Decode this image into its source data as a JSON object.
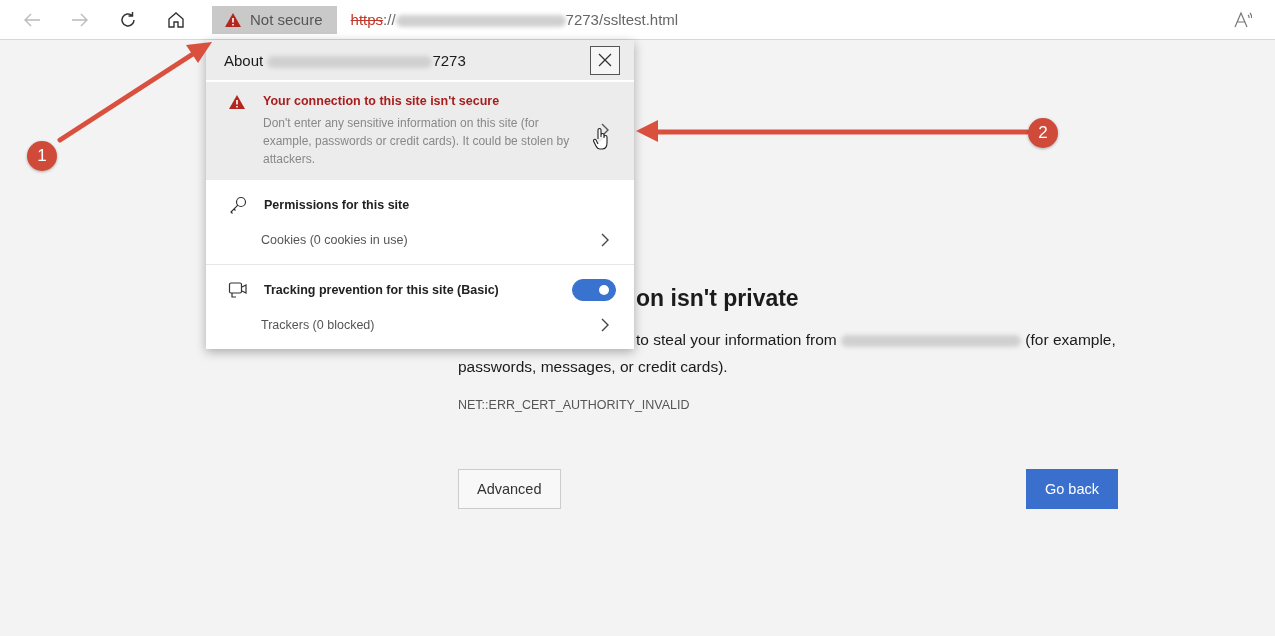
{
  "toolbar": {
    "security_chip": {
      "label": "Not secure"
    },
    "address": {
      "scheme": "https",
      "separator": "://",
      "rest": "7273/ssltest.html"
    }
  },
  "popup": {
    "title_prefix": "About",
    "title_suffix": "7273",
    "warning": {
      "title": "Your connection to this site isn't secure",
      "body": "Don't enter any sensitive information on this site (for example, passwords or credit cards). It could be stolen by attackers."
    },
    "sections": [
      {
        "kind": "permissions",
        "title": "Permissions for this site",
        "rows": [
          {
            "label": "Cookies (0 cookies in use)"
          }
        ]
      },
      {
        "kind": "tracking",
        "title": "Tracking prevention for this site (Basic)",
        "on": true,
        "rows": [
          {
            "label": "Trackers (0 blocked)"
          }
        ]
      }
    ]
  },
  "page": {
    "heading": "on isn't private",
    "paragraph": {
      "before": "to steal your information from",
      "after": "(for example, passwords, messages, or credit cards)."
    },
    "error_code": "NET::ERR_CERT_AUTHORITY_INVALID",
    "buttons": [
      {
        "kind": "secondary",
        "label": "Advanced"
      },
      {
        "kind": "primary",
        "label": "Go back"
      }
    ]
  },
  "annotations": [
    {
      "number": "1"
    },
    {
      "number": "2"
    }
  ]
}
